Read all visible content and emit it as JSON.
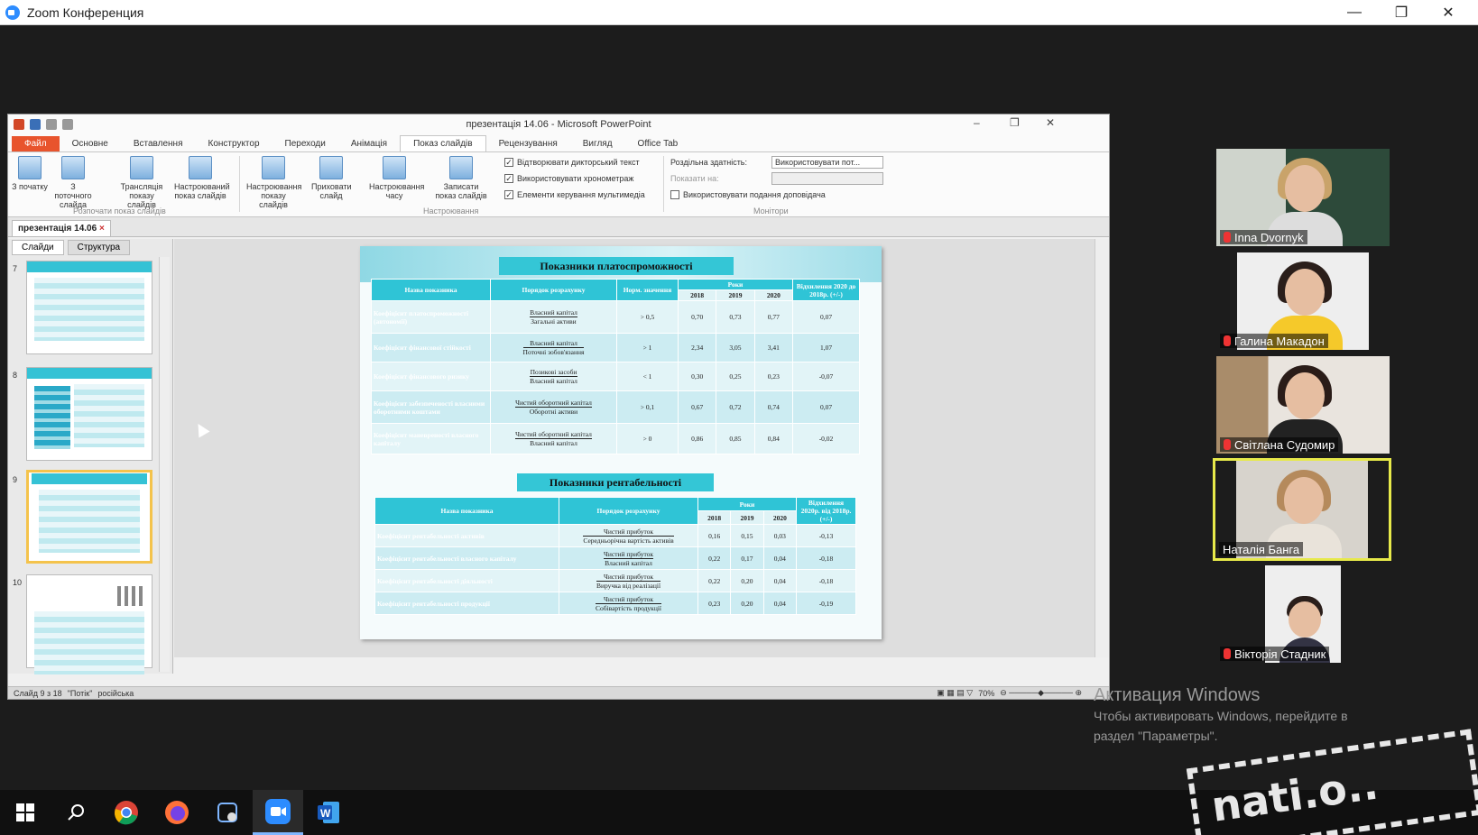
{
  "zoom": {
    "title": "Zoom Конференция",
    "min": "—",
    "restore": "❐",
    "close": "✕"
  },
  "ppt": {
    "doc_title": "презентація 14.06 - Microsoft PowerPoint",
    "tabs": [
      "Файл",
      "Основне",
      "Вставлення",
      "Конструктор",
      "Переходи",
      "Анімація",
      "Показ слайдів",
      "Рецензування",
      "Вигляд",
      "Office Tab"
    ],
    "ribbon": {
      "buttons": [
        "З початку",
        "З поточного слайда",
        "Трансляція показу слайдів",
        "Настроюваний показ слайдів",
        "Настроювання показу слайдів",
        "Приховати слайд",
        "Настроювання часу",
        "Записати показ слайдів"
      ],
      "checks": [
        "Відтворювати дикторський текст",
        "Використовувати хронометраж",
        "Елементи керування мультимедіа"
      ],
      "monitor_res": "Роздільна здатність:",
      "monitor_res_val": "Використовувати пот...",
      "show_on": "Показати на:",
      "presenter": "Використовувати подання доповідача",
      "groups": [
        "Розпочати показ слайдів",
        "Настроювання",
        "Монітори"
      ]
    },
    "doc_tab": "презентація 14.06",
    "pane_tabs": [
      "Слайди",
      "Структура"
    ],
    "thumb_numbers": [
      "7",
      "8",
      "9",
      "10"
    ],
    "status": [
      "Слайд 9 з 18",
      "\"Потік\"",
      "російська"
    ],
    "zoom_level": "70%"
  },
  "slide": {
    "t1": "Показники платоспроможності",
    "t1_headers": {
      "name": "Назва показника",
      "order": "Порядок розрахунку",
      "norm": "Норм. значення",
      "years": "Роки",
      "y": [
        "2018",
        "2019",
        "2020"
      ],
      "dev": "Відхилення 2020 до 2018р. (+/-)"
    },
    "t1_rows": [
      {
        "name": "Коефіцієнт платоспроможності (автономії)",
        "num": "Власний капітал",
        "den": "Загальні активи",
        "norm": "> 0,5",
        "v": [
          "0,70",
          "0,73",
          "0,77"
        ],
        "d": "0,07"
      },
      {
        "name": "Коефіцієнт фінансової стійкості",
        "num": "Власний капітал",
        "den": "Поточні зобов'язання",
        "norm": "> 1",
        "v": [
          "2,34",
          "3,05",
          "3,41"
        ],
        "d": "1,07"
      },
      {
        "name": "Коефіцієнт фінансового ризику",
        "num": "Позикові засоби",
        "den": "Власний капітал",
        "norm": "< 1",
        "v": [
          "0,30",
          "0,25",
          "0,23"
        ],
        "d": "-0,07"
      },
      {
        "name": "Коефіцієнт забезпеченості власними оборотними коштами",
        "num": "Чистий оборотний капітал",
        "den": "Оборотні активи",
        "norm": "> 0,1",
        "v": [
          "0,67",
          "0,72",
          "0,74"
        ],
        "d": "0,07"
      },
      {
        "name": "Коефіцієнт маневреності власного капіталу",
        "num": "Чистий оборотний капітал",
        "den": "Власний капітал",
        "norm": "> 0",
        "v": [
          "0,86",
          "0,85",
          "0,84"
        ],
        "d": "-0,02"
      }
    ],
    "t2": "Показники рентабельності",
    "t2_headers": {
      "name": "Назва показника",
      "order": "Порядок розрахунку",
      "years": "Роки",
      "y": [
        "2018",
        "2019",
        "2020"
      ],
      "dev": "Відхилення 2020р. від 2018р. (+/-)"
    },
    "t2_rows": [
      {
        "name": "Коефіцієнт рентабельності активів",
        "num": "Чистий прибуток",
        "den": "Середньорічна вартість активів",
        "v": [
          "0,16",
          "0,15",
          "0,03"
        ],
        "d": "-0,13"
      },
      {
        "name": "Коефіцієнт рентабельності власного капіталу",
        "num": "Чистий прибуток",
        "den": "Власний капітал",
        "v": [
          "0,22",
          "0,17",
          "0,04"
        ],
        "d": "-0,18"
      },
      {
        "name": "Коефіцієнт рентабельності діяльності",
        "num": "Чистий прибуток",
        "den": "Виручка від реалізації",
        "v": [
          "0,22",
          "0,20",
          "0,04"
        ],
        "d": "-0,18"
      },
      {
        "name": "Коефіцієнт рентабельності продукції",
        "num": "Чистий прибуток",
        "den": "Собівартість продукції",
        "v": [
          "0,23",
          "0,20",
          "0,04"
        ],
        "d": "-0,19"
      }
    ]
  },
  "participants": [
    "Inna Dvornyk",
    "Галина Макадон",
    "Світлана Судомир",
    "Наталія Банга",
    "Вікторія Стадник"
  ],
  "windows_activation": {
    "title": "Активация Windows",
    "line1": "Чтобы активировать Windows, перейдите в",
    "line2": "раздел \"Параметры\"."
  },
  "stamp_text": "nati.o..."
}
